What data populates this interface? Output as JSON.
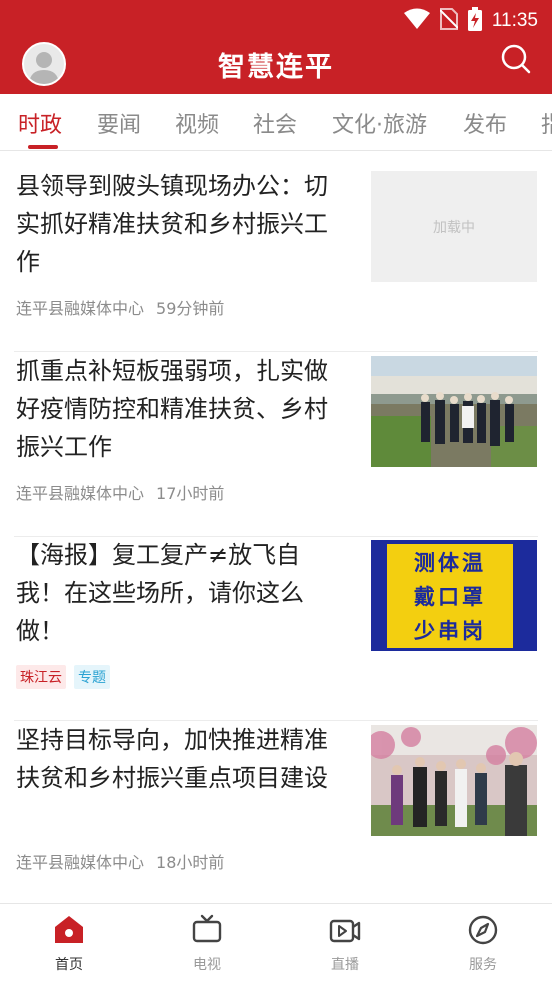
{
  "status_bar": {
    "time": "11:35"
  },
  "header": {
    "title": "智慧连平"
  },
  "tabs": [
    {
      "label": "时政",
      "active": true
    },
    {
      "label": "要闻"
    },
    {
      "label": "视频"
    },
    {
      "label": "社会"
    },
    {
      "label": "文化·旅游"
    },
    {
      "label": "发布"
    },
    {
      "label": "指"
    }
  ],
  "news": [
    {
      "title": "县领导到陂头镇现场办公：切实抓好精准扶贫和乡村振兴工作",
      "source": "连平县融媒体中心",
      "time": "59分钟前",
      "thumb_placeholder": "加载中"
    },
    {
      "title": "抓重点补短板强弱项，扎实做好疫情防控和精准扶贫、乡村振兴工作",
      "source": "连平县融媒体中心",
      "time": "17小时前"
    },
    {
      "title": "【海报】复工复产≠放飞自我！在这些场所，请你这么做！",
      "tags": [
        "珠江云",
        "专题"
      ],
      "poster_lines": [
        "测体温",
        "戴口罩",
        "少串岗"
      ]
    },
    {
      "title": "坚持目标导向，加快推进精准扶贫和乡村振兴重点项目建设",
      "source": "连平县融媒体中心",
      "time": "18小时前"
    }
  ],
  "bottom_nav": [
    {
      "label": "首页",
      "icon": "home-icon",
      "active": true
    },
    {
      "label": "电视",
      "icon": "tv-icon"
    },
    {
      "label": "直播",
      "icon": "live-video-icon"
    },
    {
      "label": "服务",
      "icon": "compass-icon"
    }
  ],
  "colors": {
    "brand_red": "#c82126",
    "tag_red": "#c82126",
    "tag_blue": "#2aa2d2",
    "poster_yellow": "#f3cf10",
    "poster_blue": "#1c2b9c"
  }
}
